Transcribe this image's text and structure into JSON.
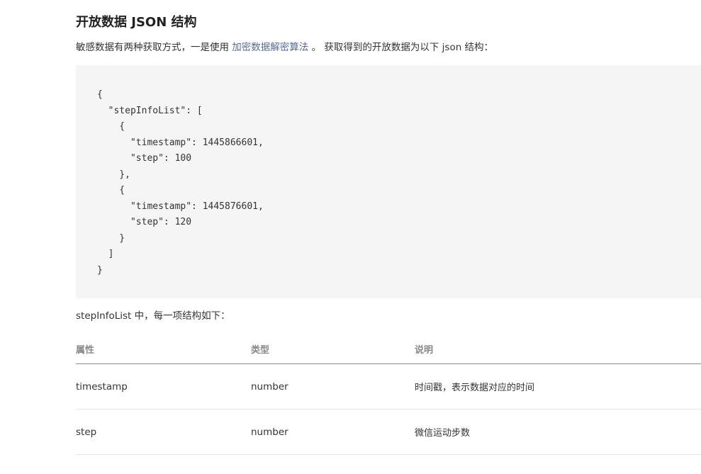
{
  "title": "开放数据 JSON 结构",
  "intro": {
    "before": "敏感数据有两种获取方式，一是使用 ",
    "link": "加密数据解密算法",
    "after": " 。 获取得到的开放数据为以下 json 结构："
  },
  "code": "{\n  \"stepInfoList\": [\n    {\n      \"timestamp\": 1445866601,\n      \"step\": 100\n    },\n    {\n      \"timestamp\": 1445876601,\n      \"step\": 120\n    }\n  ]\n}",
  "subtitle": "stepInfoList 中，每一项结构如下：",
  "table": {
    "headers": [
      "属性",
      "类型",
      "说明"
    ],
    "rows": [
      [
        "timestamp",
        "number",
        "时间戳，表示数据对应的时间"
      ],
      [
        "step",
        "number",
        "微信运动步数"
      ]
    ]
  }
}
